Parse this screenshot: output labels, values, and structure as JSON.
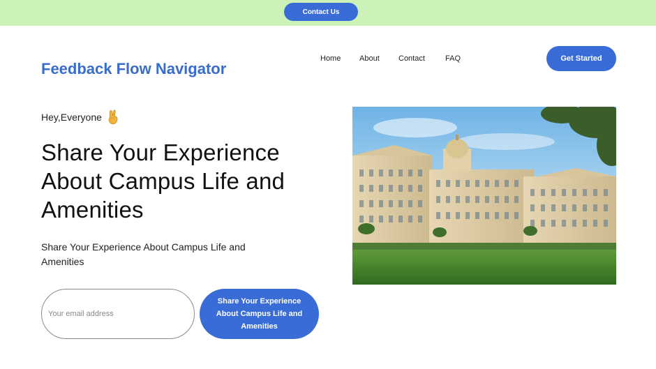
{
  "banner": {
    "contact_label": "Contact Us",
    "background_color": "#ccf2b8"
  },
  "header": {
    "brand": "Feedback Flow Navigator",
    "brand_color": "#3a6cc9",
    "nav": {
      "home": "Home",
      "about": "About",
      "contact": "Contact",
      "faq": "FAQ"
    },
    "cta_label": "Get Started"
  },
  "hero": {
    "greeting": "Hey,Everyone",
    "greeting_icon": "peace-hand-icon",
    "heading": "Share Your Experience About Campus Life and Amenities",
    "subheading": "Share Your Experience About Campus Life and Amenities",
    "email_placeholder": "Your email address",
    "email_value": "",
    "share_button_label": "Share Your Experience About Campus Life and Amenities",
    "image_subject": "campus-building-photo"
  },
  "colors": {
    "accent": "#3a6cd8"
  }
}
